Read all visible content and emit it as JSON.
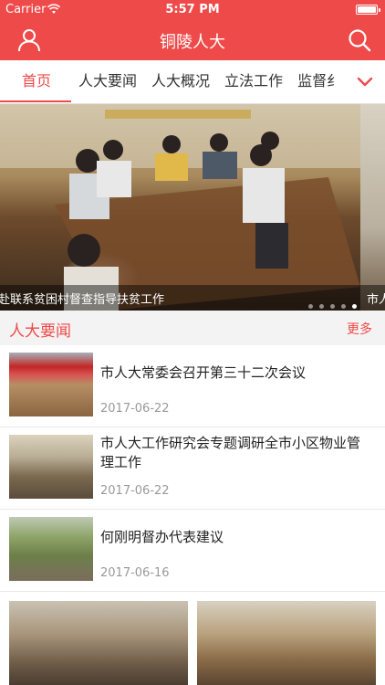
{
  "status_bar": {
    "carrier": "Carrier",
    "time": "5:57 PM"
  },
  "nav": {
    "title": "铜陵人大",
    "left_icon": "user-icon",
    "right_icon": "search-icon"
  },
  "tabs": [
    {
      "label": "首页",
      "active": true
    },
    {
      "label": "人大要闻",
      "active": false
    },
    {
      "label": "人大概况",
      "active": false
    },
    {
      "label": "立法工作",
      "active": false
    },
    {
      "label": "监督纟",
      "active": false
    }
  ],
  "tabs_more_icon": "chevron-down-icon",
  "banner": {
    "caption": "祥生赴联系贫困村督查指导扶贫工作",
    "next_caption": "市人",
    "dots_total": 5,
    "dot_active": 4
  },
  "section": {
    "heading": "人大要闻",
    "more": "更多"
  },
  "news": [
    {
      "title": "市人大常委会召开第三十二次会议",
      "date": "2017-06-22"
    },
    {
      "title": "市人大工作研究会专题调研全市小区物业管理工作",
      "date": "2017-06-22"
    },
    {
      "title": "何刚明督办代表建议",
      "date": "2017-06-16"
    }
  ],
  "colors": {
    "brand": "#ef4a4a",
    "date": "#999999"
  }
}
